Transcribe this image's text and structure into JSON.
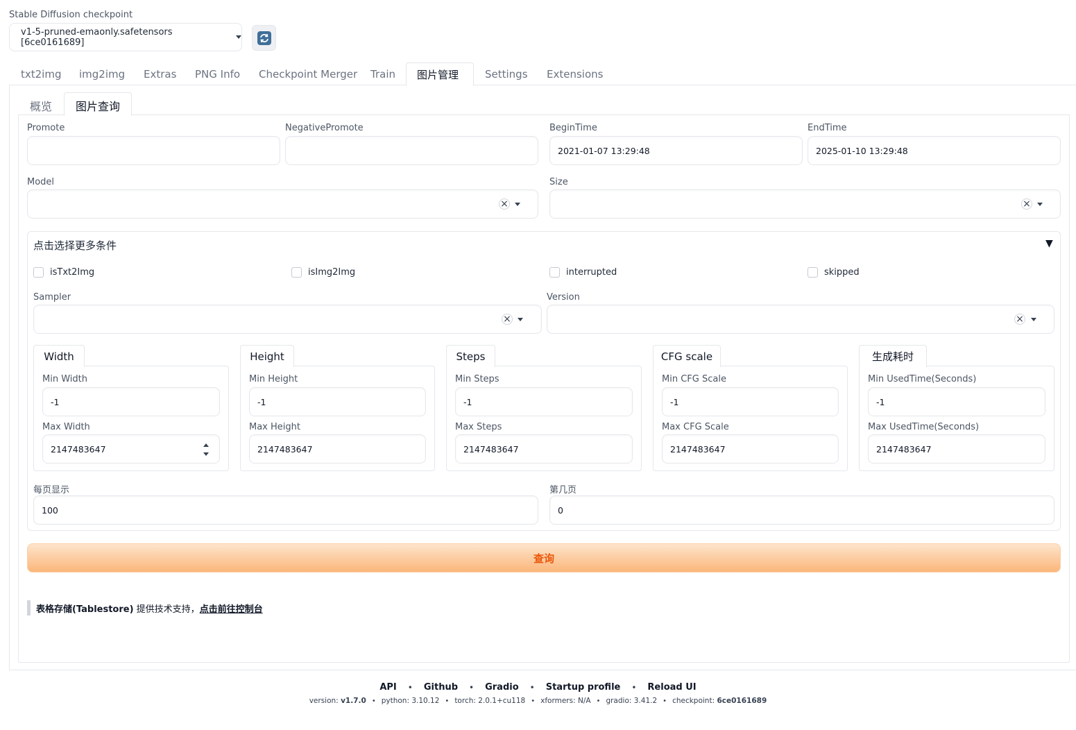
{
  "checkpoint": {
    "label": "Stable Diffusion checkpoint",
    "value": "v1-5-pruned-emaonly.safetensors [6ce0161689]"
  },
  "main_tabs": [
    "txt2img",
    "img2img",
    "Extras",
    "PNG Info",
    "Checkpoint Merger",
    "Train",
    "图片管理",
    "Settings",
    "Extensions"
  ],
  "sub_tabs": [
    "概览",
    "图片查询"
  ],
  "fields": {
    "promote_label": "Promote",
    "promote_value": "",
    "negative_label": "NegativePromote",
    "negative_value": "",
    "begin_label": "BeginTime",
    "begin_value": "2021-01-07 13:29:48",
    "end_label": "EndTime",
    "end_value": "2025-01-10 13:29:48",
    "model_label": "Model",
    "size_label": "Size"
  },
  "more": {
    "title": "点击选择更多条件",
    "toggle": "▼",
    "checkboxes": [
      "isTxt2Img",
      "isImg2Img",
      "interrupted",
      "skipped"
    ],
    "sampler_label": "Sampler",
    "version_label": "Version"
  },
  "groups": [
    {
      "tab": "Width",
      "min_label": "Min Width",
      "min_value": "-1",
      "max_label": "Max Width",
      "max_value": "2147483647"
    },
    {
      "tab": "Height",
      "min_label": "Min Height",
      "min_value": "-1",
      "max_label": "Max Height",
      "max_value": "2147483647"
    },
    {
      "tab": "Steps",
      "min_label": "Min Steps",
      "min_value": "-1",
      "max_label": "Max Steps",
      "max_value": "2147483647"
    },
    {
      "tab": "CFG scale",
      "min_label": "Min CFG Scale",
      "min_value": "-1",
      "max_label": "Max CFG Scale",
      "max_value": "2147483647"
    },
    {
      "tab": "生成耗时",
      "min_label": "Min UsedTime(Seconds)",
      "min_value": "-1",
      "max_label": "Max UsedTime(Seconds)",
      "max_value": "2147483647"
    }
  ],
  "paging": {
    "per_page_label": "每页显示",
    "per_page_value": "100",
    "page_label": "第几页",
    "page_value": "0"
  },
  "query_button": "查询",
  "support": {
    "bold": "表格存储(Tablestore)",
    "text": " 提供技术支持，",
    "link": "点击前往控制台"
  },
  "footer": {
    "links": [
      "API",
      "Github",
      "Gradio",
      "Startup profile",
      "Reload UI"
    ],
    "version_prefix": "version: ",
    "version": "v1.7.0",
    "python": "python: 3.10.12",
    "torch": "torch: 2.0.1+cu118",
    "xformers": "xformers: N/A",
    "gradio": "gradio: 3.41.2",
    "checkpoint_prefix": "checkpoint: ",
    "checkpoint": "6ce0161689"
  },
  "colors": {
    "accent_orange": "#ea580c",
    "button_gradient_top": "#fde4cc",
    "button_gradient_bottom": "#fbb67a"
  }
}
